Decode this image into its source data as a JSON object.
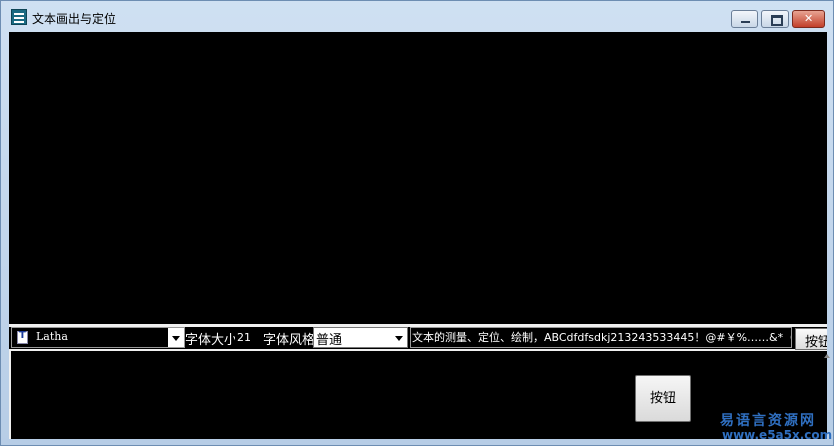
{
  "window": {
    "title": "文本画出与定位"
  },
  "toolbar": {
    "font_value": "Latha",
    "size_label": "字体大小",
    "size_value": "21",
    "style_label": "字体风格",
    "style_value": "普通",
    "text_value": "文本的测量、定位、绘制，ABCdfdfsdkj213243533445！@#￥%……&*（）",
    "small_button_label": "按钮"
  },
  "main_button_label": "按钮",
  "watermark": {
    "line1": "易语言资源网",
    "line2": "www.e5a5x.com"
  },
  "icons": {
    "app": "app-icon",
    "font_type": "font-type-icon",
    "dropdown": "chevron-down-icon",
    "minimize": "minimize-icon",
    "maximize": "maximize-icon",
    "close": "close-icon"
  },
  "colors": {
    "canvas": "#000000",
    "title_bar": "#b9d1ea",
    "close": "#c23f2a",
    "watermark": "#2f6fc0"
  }
}
